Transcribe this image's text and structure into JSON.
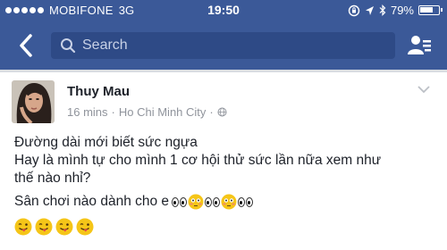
{
  "status_bar": {
    "carrier": "MOBIFONE",
    "network": "3G",
    "time": "19:50",
    "battery": "79%",
    "battery_level": 0.79
  },
  "nav": {
    "search_placeholder": "Search"
  },
  "post": {
    "author": "Thuy Mau",
    "time": "16 mins",
    "separator": "·",
    "location": "Ho Chi Minh City",
    "line1": "Đường dài mới biết sức ngựa",
    "line2": "Hay là mình tự cho mình 1 cơ hội thử sức lần nữa xem như",
    "line3": "thế nào nhỉ?",
    "line4": "Sân chơi nào dành cho e"
  },
  "colors": {
    "brand": "#3b5998",
    "emoji_face": "#f5c518"
  },
  "icons": {
    "back": "chevron-left-icon",
    "search": "search-icon",
    "friends": "friend-requests-icon",
    "privacy": "globe-icon",
    "menu": "chevron-down-icon",
    "emoji_inline": [
      "eyes",
      "flushed-face",
      "eyes",
      "flushed-face",
      "eyes"
    ],
    "emoji_row": [
      "winking-tongue-face",
      "winking-tongue-face",
      "winking-tongue-face",
      "winking-tongue-face"
    ]
  }
}
